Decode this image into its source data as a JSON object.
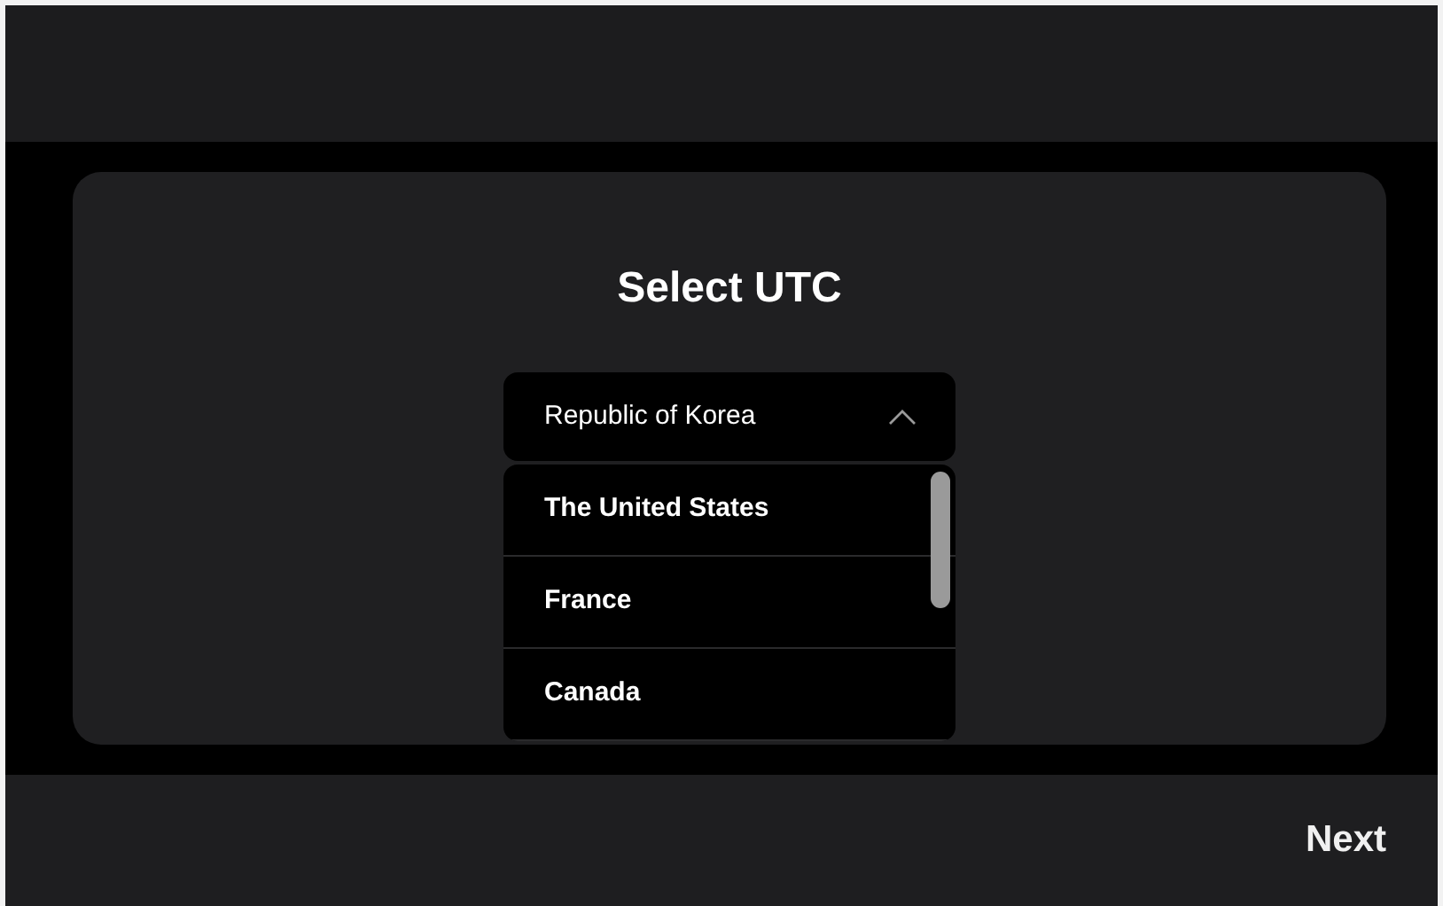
{
  "title": "Select UTC",
  "dropdown": {
    "value": "Republic of Korea",
    "expanded": true,
    "options": [
      {
        "label": "The United States"
      },
      {
        "label": "France"
      },
      {
        "label": "Canada"
      }
    ]
  },
  "footer": {
    "button": "Next"
  }
}
